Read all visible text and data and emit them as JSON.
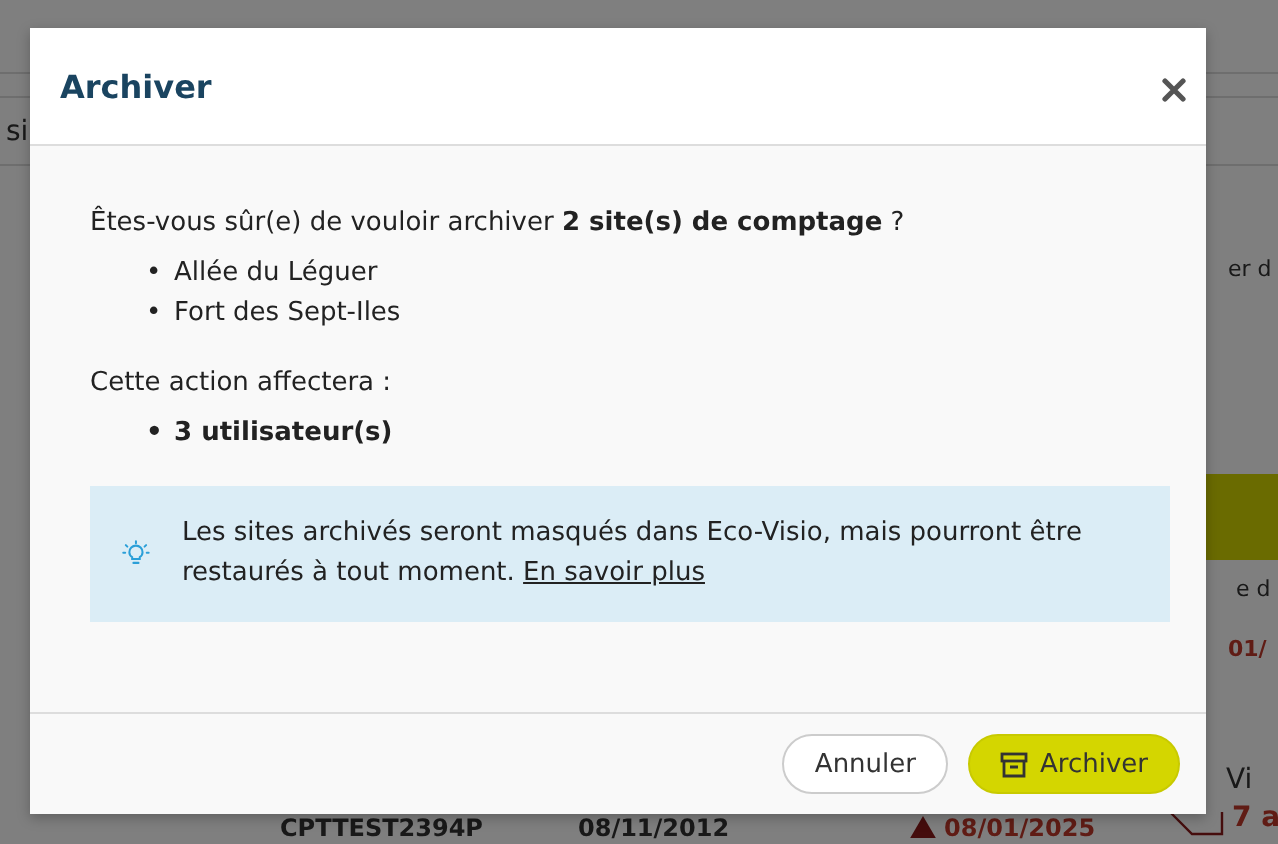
{
  "background": {
    "left_label": "si",
    "right_texts": [
      "er d",
      "e d"
    ],
    "right_date": "01/",
    "row": {
      "code": "CPTTEST2394P",
      "date": "08/11/2012",
      "alert_date": "08/01/2025",
      "column_4": "Vi",
      "count": "7 a"
    }
  },
  "dialog": {
    "title": "Archiver",
    "question": "Êtes-vous sûr(e) de vouloir archiver **2 site(s) de comptage** ?",
    "bullet": "•",
    "sites": [
      "Allée du Léguer",
      "Fort des Sept-Iles"
    ],
    "impact_label": "Cette action affectera :",
    "impacts": [
      "3 utilisateur(s)"
    ],
    "info": {
      "text": "Les sites archivés seront masqués dans Eco-Visio, mais pourront être restaurés à tout moment.",
      "link": "En savoir plus"
    },
    "buttons": [
      {
        "label": "Annuler",
        "kind": "secondary"
      },
      {
        "label": "Archiver",
        "kind": "primary"
      }
    ]
  }
}
